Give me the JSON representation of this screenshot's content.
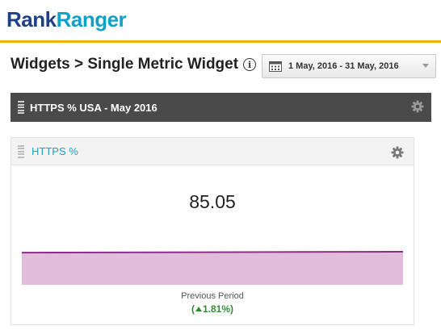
{
  "header": {
    "logo_part1": "Rank",
    "logo_part2": "Ranger"
  },
  "page": {
    "title": "Widgets > Single Metric Widget"
  },
  "date_picker": {
    "value": "1 May, 2016 - 31 May, 2016"
  },
  "dashboard": {
    "title": "HTTPS % USA - May 2016"
  },
  "widget": {
    "title": "HTTPS %",
    "metric_value": "85.05",
    "previous_label": "Previous Period",
    "change_open": "(",
    "change_value": "1.81%)",
    "trend": "up"
  },
  "chart_data": {
    "type": "area",
    "title": "",
    "xlabel": "",
    "ylabel": "",
    "x": [
      1,
      31
    ],
    "series": [
      {
        "values": [
          85.04,
          85.07
        ]
      }
    ],
    "ylim": [
      0,
      100
    ],
    "grid": false
  },
  "colors": {
    "accent_yellow": "#f0b400",
    "logo_dark": "#1f3f86",
    "logo_light": "#10a0c8",
    "area_fill": "#e2bddb",
    "area_line": "#8c2d86",
    "positive": "#2f8f2f"
  }
}
